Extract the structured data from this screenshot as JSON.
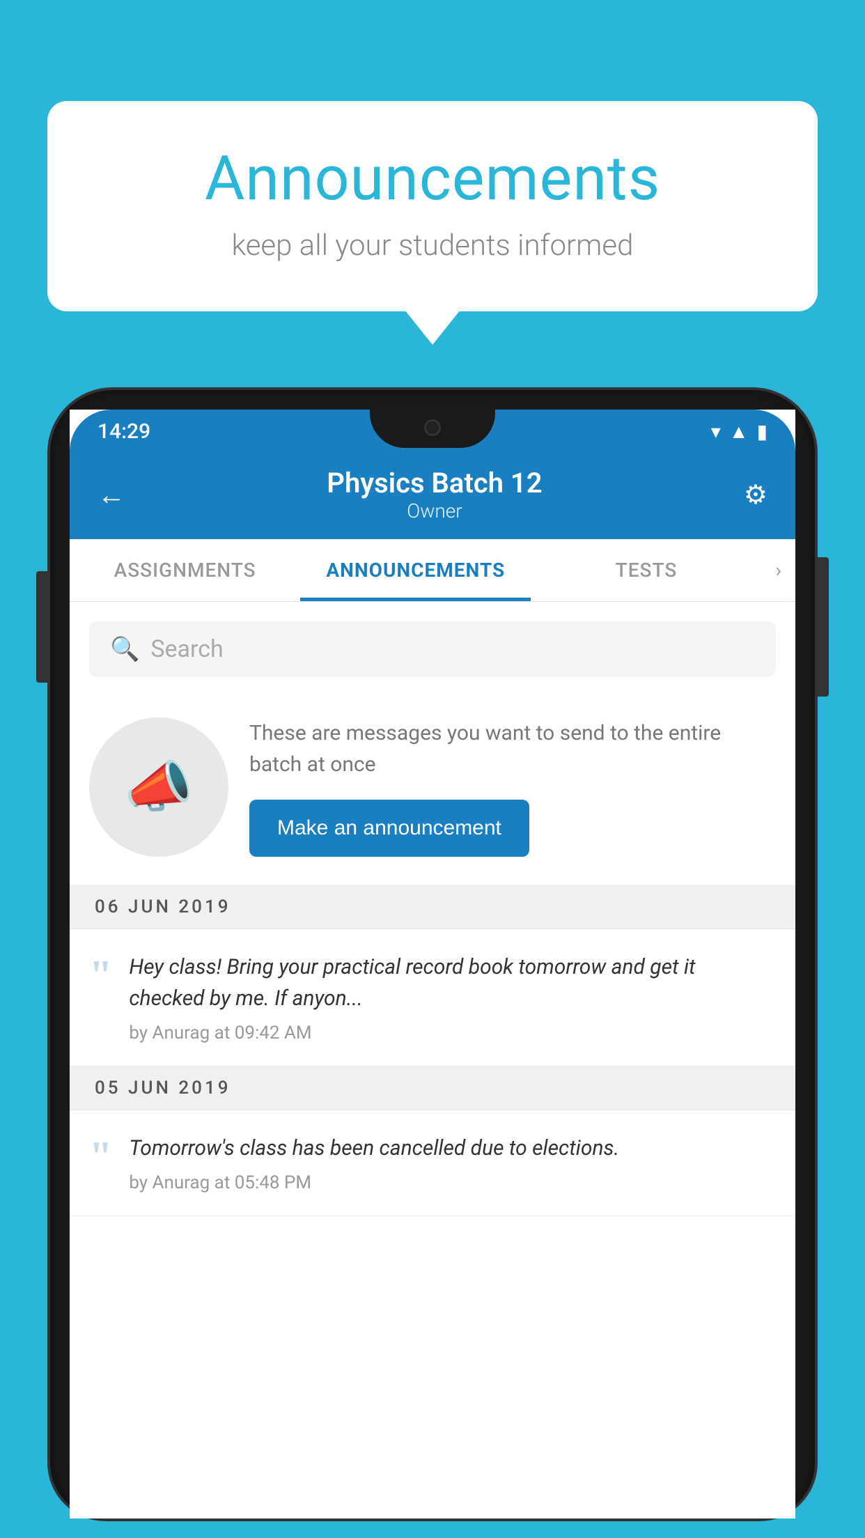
{
  "background_color": "#29b6d8",
  "speech_bubble": {
    "title": "Announcements",
    "subtitle": "keep all your students informed"
  },
  "phone": {
    "status_bar": {
      "time": "14:29"
    },
    "header": {
      "title": "Physics Batch 12",
      "subtitle": "Owner",
      "back_label": "←",
      "settings_label": "⚙"
    },
    "tabs": [
      {
        "label": "ASSIGNMENTS",
        "active": false
      },
      {
        "label": "ANNOUNCEMENTS",
        "active": true
      },
      {
        "label": "TESTS",
        "active": false
      }
    ],
    "search": {
      "placeholder": "Search"
    },
    "empty_state": {
      "description": "These are messages you want to send to the entire batch at once",
      "button_label": "Make an announcement"
    },
    "announcements": [
      {
        "date": "06  JUN  2019",
        "text": "Hey class! Bring your practical record book tomorrow and get it checked by me. If anyon...",
        "meta": "by Anurag at 09:42 AM"
      },
      {
        "date": "05  JUN  2019",
        "text": "Tomorrow's class has been cancelled due to elections.",
        "meta": "by Anurag at 05:48 PM"
      }
    ]
  }
}
